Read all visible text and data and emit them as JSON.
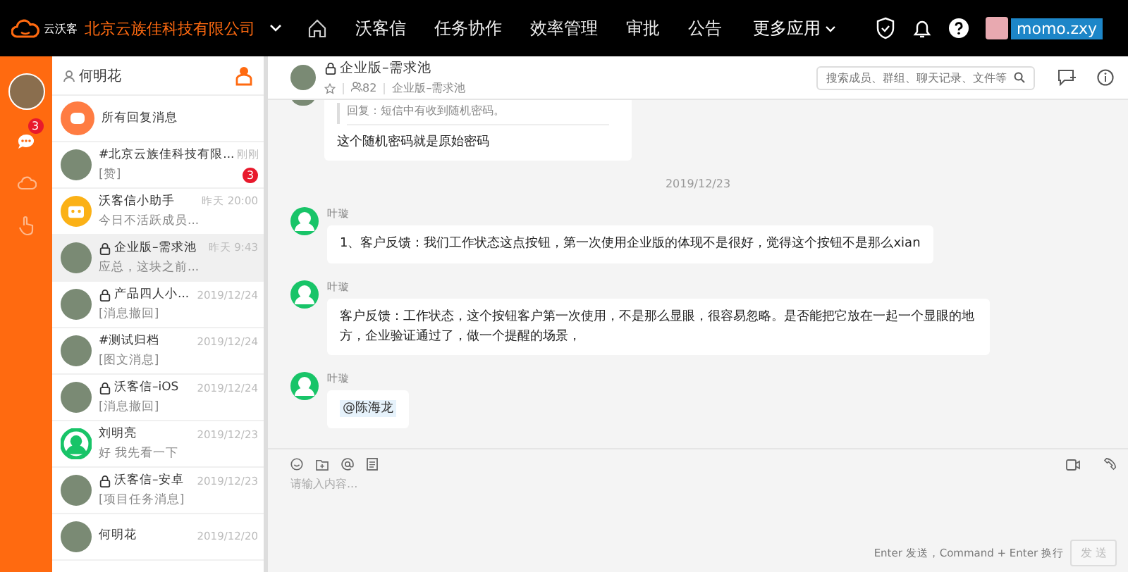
{
  "topbar": {
    "logo_text": "云沃客",
    "company": "北京云族佳科技有限公司",
    "nav": [
      {
        "label": "沃客信",
        "selected": false
      },
      {
        "label": "任务协作",
        "selected": false
      },
      {
        "label": "效率管理",
        "selected": false
      },
      {
        "label": "审批",
        "selected": false
      },
      {
        "label": "公告",
        "selected": false
      }
    ],
    "more": "更多应用",
    "user": "momo.zxy"
  },
  "rail": [
    {
      "kind": "chat",
      "badge": "3",
      "selected": true
    },
    {
      "kind": "cloud",
      "selected": false
    },
    {
      "kind": "hand",
      "selected": false
    }
  ],
  "conversation_list": {
    "owner": "何明花",
    "items": [
      {
        "kind": "replies",
        "name": "所有回复消息",
        "selected": false
      },
      {
        "kind": "group",
        "locked": false,
        "name": "#北京云族佳科技有限...",
        "time": "刚刚",
        "preview": "[赞]",
        "badge": "3",
        "selected": false
      },
      {
        "kind": "bot",
        "locked": false,
        "name": "沃客信小助手",
        "time": "昨天 20:00",
        "preview": "今日不活跃成员...",
        "selected": false
      },
      {
        "kind": "group",
        "locked": true,
        "name": "企业版–需求池",
        "time": "昨天 9:43",
        "preview": "应总，这块之前...",
        "selected": true
      },
      {
        "kind": "group",
        "locked": true,
        "name": "产品四人小...",
        "time": "2019/12/24",
        "preview": "[消息撤回]",
        "selected": false
      },
      {
        "kind": "group",
        "locked": false,
        "name": "#测试归档",
        "time": "2019/12/24",
        "preview": "[图文消息]",
        "selected": false
      },
      {
        "kind": "group",
        "locked": true,
        "name": "沃客信–iOS",
        "time": "2019/12/24",
        "preview": "[消息撤回]",
        "selected": false
      },
      {
        "kind": "person",
        "locked": false,
        "name": "刘明亮",
        "time": "2019/12/23",
        "preview": "好 我先看一下",
        "selected": false
      },
      {
        "kind": "group",
        "locked": true,
        "name": "沃客信–安卓",
        "time": "2019/12/23",
        "preview": "[项目任务消息]",
        "selected": false
      },
      {
        "kind": "group",
        "locked": false,
        "name": "何明花",
        "time": "2019/12/20",
        "selected": false
      }
    ]
  },
  "chat": {
    "title": "企业版–需求池",
    "locked": true,
    "members": "82",
    "subtitle": "企业版–需求池",
    "search_placeholder": "搜索成员、群组、聊天记录、文件等",
    "messages": [
      {
        "kind": "reply",
        "quote": "回复：短信中有收到随机密码。",
        "text": "这个随机密码就是原始密码"
      },
      {
        "kind": "date",
        "text": "2019/12/23"
      },
      {
        "kind": "message",
        "sender": "叶璇",
        "text": "1、客户反馈：我们工作状态这点按钮，第一次使用企业版的体现不是很好，觉得这个按钮不是那么xian"
      },
      {
        "kind": "message",
        "sender": "叶璇",
        "text": "客户反馈：工作状态，这个按钮客户第一次使用，不是那么显眼，很容易忽略。是否能把它放在一起一个显眼的地方，企业验证通过了，做一个提醒的场景，"
      },
      {
        "kind": "mention",
        "sender": "叶璇",
        "text": "@陈海龙"
      }
    ],
    "input_placeholder": "请输入内容...",
    "hint": "Enter 发送，Command + Enter 换行",
    "send": "发 送"
  }
}
